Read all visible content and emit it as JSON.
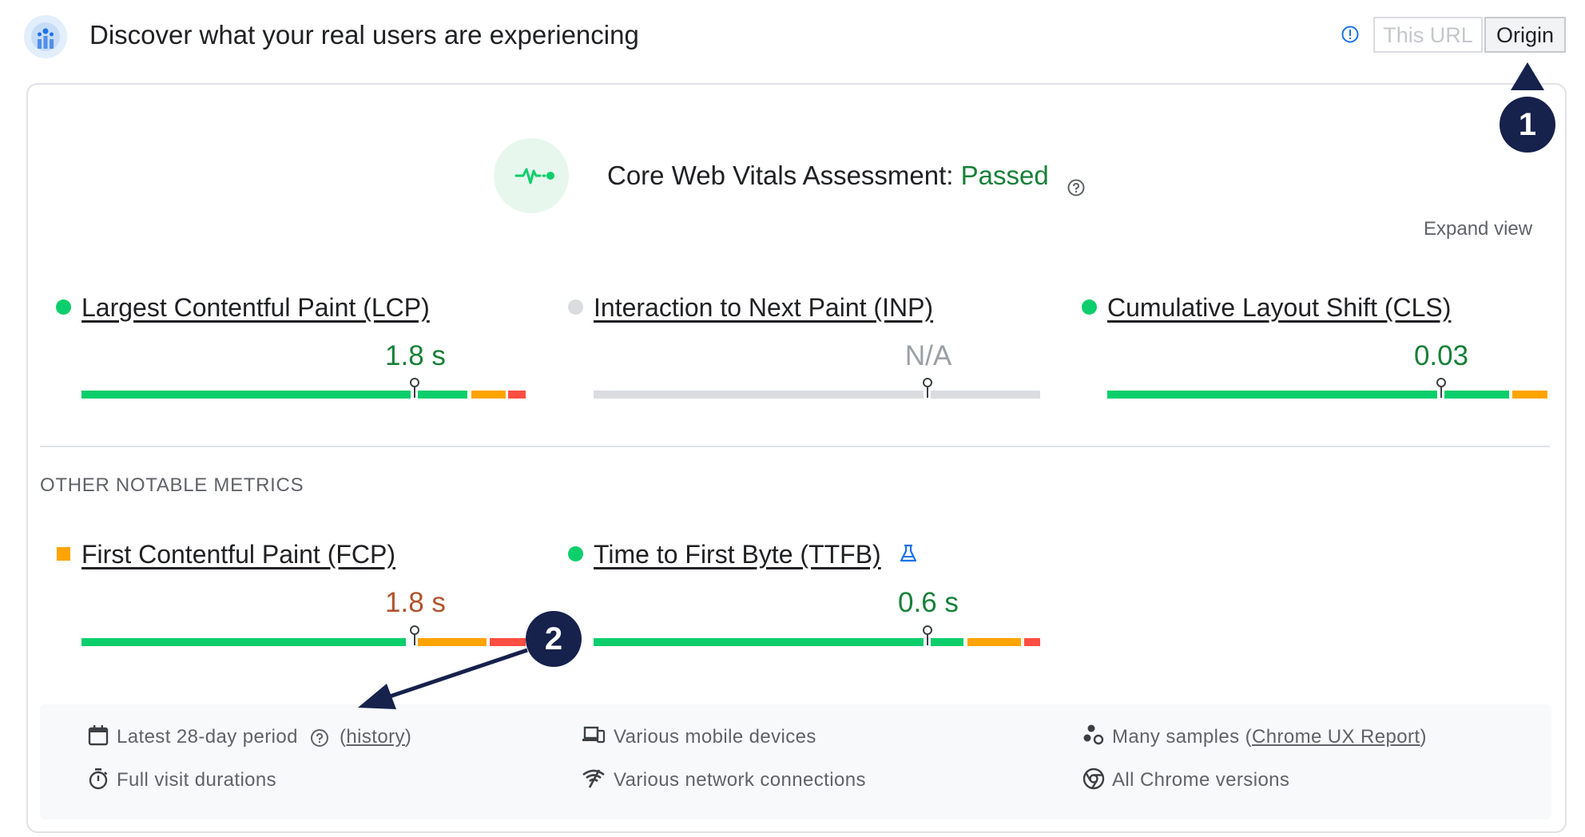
{
  "header": {
    "title": "Discover what your real users are experiencing",
    "tab_url": "This URL",
    "tab_origin": "Origin"
  },
  "assessment": {
    "prefix": "Core Web Vitals Assessment:",
    "result": "Passed",
    "expand": "Expand view"
  },
  "core_metrics": [
    {
      "label": "Largest Contentful Paint (LCP)",
      "value": "1.8 s",
      "status": "good"
    },
    {
      "label": "Interaction to Next Paint (INP)",
      "value": "N/A",
      "status": "none"
    },
    {
      "label": "Cumulative Layout Shift (CLS)",
      "value": "0.03",
      "status": "good"
    }
  ],
  "other_metrics_heading": "OTHER NOTABLE METRICS",
  "other_metrics": [
    {
      "label": "First Contentful Paint (FCP)",
      "value": "1.8 s",
      "status": "needs-improvement"
    },
    {
      "label": "Time to First Byte (TTFB)",
      "value": "0.6 s",
      "status": "good"
    }
  ],
  "footer": {
    "period": "Latest 28-day period",
    "history": "history",
    "durations": "Full visit durations",
    "devices": "Various mobile devices",
    "network": "Various network connections",
    "samples_prefix": "Many samples (",
    "samples_link": "Chrome UX Report",
    "samples_suffix": ")",
    "versions": "All Chrome versions"
  },
  "markers": [
    "1",
    "2"
  ],
  "colors": {
    "good": "#0cce6b",
    "needs_improvement": "#ffa400",
    "poor": "#ff4e42",
    "neutral_dot": "#dadce0",
    "good_text": "#188038",
    "ni_text": "#b0542b",
    "marker_bg": "#16214c"
  }
}
